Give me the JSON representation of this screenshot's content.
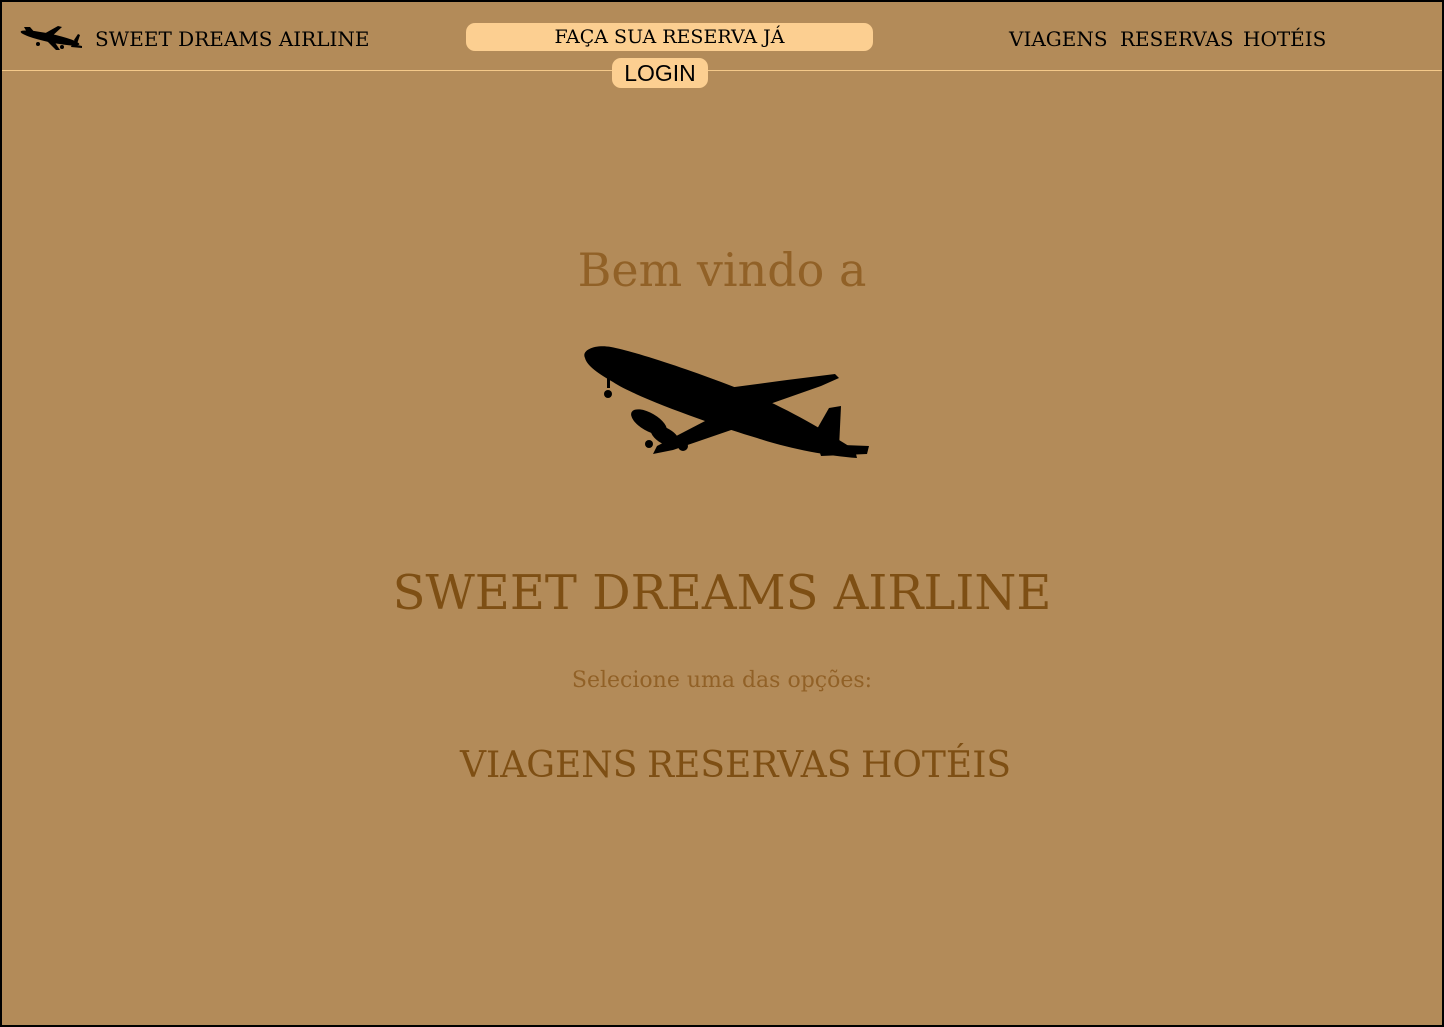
{
  "header": {
    "logo_icon": "airplane-icon",
    "brand": "SWEET DREAMS AIRLINE",
    "reserve_button": "FAÇA SUA RESERVA JÁ",
    "login_button": "LOGIN",
    "nav": [
      "VIAGENS",
      "RESERVAS",
      "HOTÉIS"
    ]
  },
  "main": {
    "welcome": "Bem vindo a",
    "hero_icon": "airplane-icon",
    "title": "SWEET DREAMS AIRLINE",
    "subtitle": "Selecione uma das opções:",
    "options": [
      "VIAGENS",
      "RESERVAS",
      "HOTÉIS"
    ]
  },
  "colors": {
    "background": "#b38b59",
    "button": "#fccf91",
    "accent_text": "#7e4f14",
    "divider": "#f4c98a"
  }
}
